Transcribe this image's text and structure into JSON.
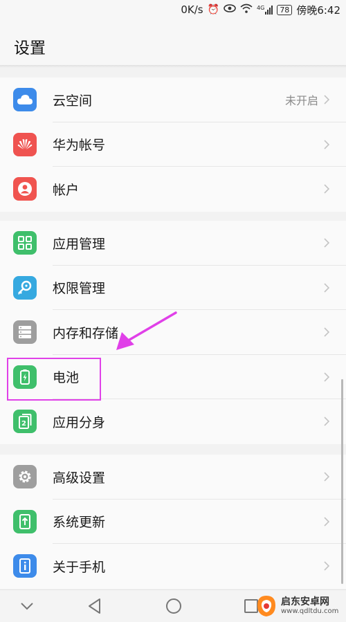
{
  "status_bar": {
    "speed": "0K/s",
    "network": "4G",
    "battery": "78",
    "time": "傍晚6:42"
  },
  "header": {
    "title": "设置"
  },
  "groups": [
    {
      "items": [
        {
          "label": "云空间",
          "value": "未开启",
          "icon": "cloud-icon",
          "color": "#3d8bea"
        },
        {
          "label": "华为帐号",
          "icon": "huawei-icon",
          "color": "#ef5350"
        },
        {
          "label": "帐户",
          "icon": "user-icon",
          "color": "#f0544f"
        }
      ]
    },
    {
      "items": [
        {
          "label": "应用管理",
          "icon": "apps-icon",
          "color": "#3fbf6b"
        },
        {
          "label": "权限管理",
          "icon": "key-icon",
          "color": "#36a9e0"
        },
        {
          "label": "内存和存储",
          "icon": "storage-icon",
          "color": "#9e9e9e"
        },
        {
          "label": "电池",
          "icon": "battery-icon",
          "color": "#3fbf6b"
        },
        {
          "label": "应用分身",
          "icon": "app-twin-icon",
          "color": "#3fbf6b"
        }
      ]
    },
    {
      "items": [
        {
          "label": "高级设置",
          "icon": "gear-icon",
          "color": "#9e9e9e"
        },
        {
          "label": "系统更新",
          "icon": "update-icon",
          "color": "#3fbf6b"
        },
        {
          "label": "关于手机",
          "icon": "phone-info-icon",
          "color": "#3d8bea"
        }
      ]
    }
  ],
  "annotation": {
    "highlight_color": "#e040e8"
  },
  "watermark": {
    "title": "启东安卓网",
    "url": "www.qdltdu.com"
  }
}
